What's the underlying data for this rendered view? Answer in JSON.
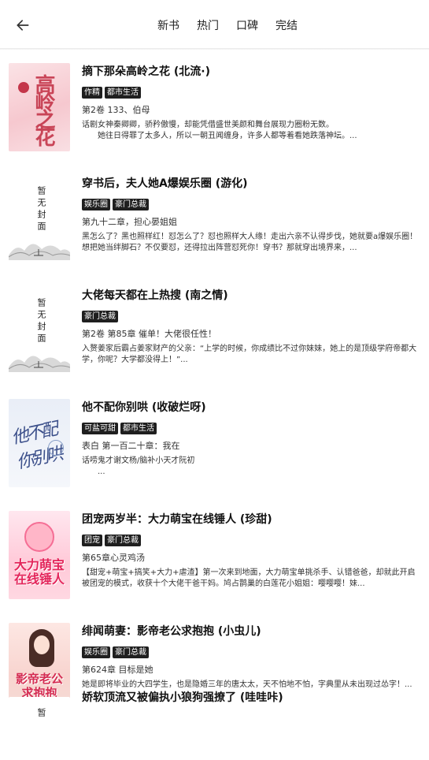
{
  "header": {
    "tabs": [
      {
        "label": "新书",
        "active": true
      },
      {
        "label": "热门",
        "active": false
      },
      {
        "label": "口碑",
        "active": false
      },
      {
        "label": "完结",
        "active": false
      }
    ]
  },
  "books": [
    {
      "title": "摘下那朵高岭之花 (北流·)",
      "tags": [
        "作精",
        "都市生活"
      ],
      "chapter": "第2卷 133、伯母",
      "desc": "话剧女神秦卿卿，骄矜傲慢，却能凭借盛世美颜和舞台展现力圈粉无数。\n　　她往日得罪了太多人，所以一朝丑闻缠身，许多人都等着看她跌落神坛。...",
      "cover_text": "高岭之花"
    },
    {
      "title": "穿书后，夫人她A爆娱乐圈 (游化)",
      "tags": [
        "娱乐圈",
        "豪门总裁"
      ],
      "chapter": "第九十二章，担心晏姐姐",
      "desc": "黑怎么了？黑也照样红！怼怎么了？怼也照样大人缘！走出六亲不认得步伐，她就要a爆娱乐圈！想把她当绊脚石？不仅要怼，还得拉出阵营怼死你！穿书？那就穿出境界来，...",
      "cover_text": "暂无封面"
    },
    {
      "title": "大佬每天都在上热搜 (南之情)",
      "tags": [
        "豪门总裁"
      ],
      "chapter": "第2卷 第85章 催单！大佬很任性！",
      "desc": "入赘姜家后霸占姜家财产的父亲：“上学的时候，你成绩比不过你妹妹，她上的是顶级学府帝都大学，你呢？大学都没得上！”...",
      "cover_text": "暂无封面"
    },
    {
      "title": "他不配你别哄 (收破烂呀)",
      "tags": [
        "可盐可甜",
        "都市生活"
      ],
      "chapter": "表白 第一百二十章：我在",
      "desc": "话唠鬼才谢文杨/脑补小天才阮初\n　　...",
      "cover_text": "他不配你别哄"
    },
    {
      "title": "团宠两岁半：大力萌宝在线锤人 (珍甜)",
      "tags": [
        "团宠",
        "豪门总裁"
      ],
      "chapter": "第65章心灵鸡汤",
      "desc": "【甜宠+萌宝+搞笑+大力+虐渣】第一次来到地面，大力萌宝单挑杀手、认错爸爸，却就此开启被团宠的模式，收获十个大佬干爸干妈。鸠占鹊巢的白莲花小姐姐：嘤嘤嘤！妹...",
      "cover_text": "大力萌宝在线锤人"
    },
    {
      "title": "绯闻萌妻：影帝老公求抱抱 (小虫儿)",
      "tags": [
        "娱乐圈",
        "豪门总裁"
      ],
      "chapter": "第624章 目标是她",
      "desc": "她是即将毕业的大四学生，也是隐婚三年的唐太太，天不怕地不怕，字典里从未出现过怂字！...",
      "cover_text": "影帝老公求抱抱"
    },
    {
      "title": "娇软顶流又被偏执小狼狗强撩了 (哇哇咔)",
      "cover_text": "暂"
    }
  ]
}
